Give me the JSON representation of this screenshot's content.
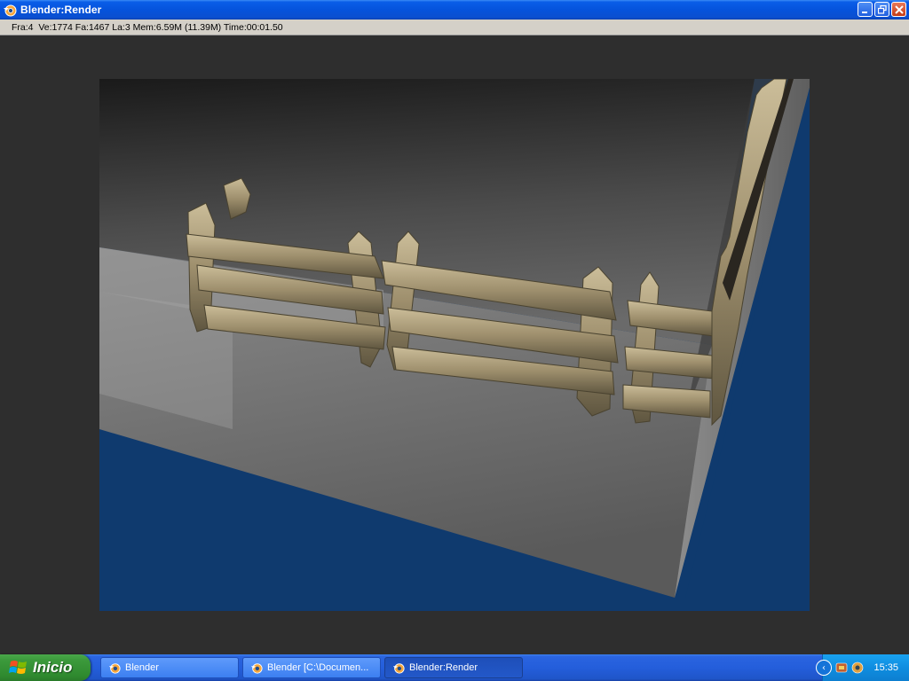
{
  "window": {
    "title": "Blender:Render"
  },
  "stats": {
    "text": "Fra:4  Ve:1774 Fa:1467 La:3 Mem:6.59M (11.39M) Time:00:01.50"
  },
  "taskbar": {
    "start_label": "Inicio",
    "tasks": [
      {
        "label": "Blender"
      },
      {
        "label": "Blender [C:\\Documen..."
      },
      {
        "label": "Blender:Render"
      }
    ],
    "clock": "15:35"
  },
  "colors": {
    "xp_blue": "#245edb",
    "start_green": "#3c9a3c",
    "render_blue": "#0f3a6e",
    "wood": "#a59574"
  },
  "icons": [
    "blender-logo-icon",
    "minimize-icon",
    "maximize-icon",
    "close-icon",
    "windows-logo-icon",
    "tray-chevron-icon",
    "tray-app-icon"
  ]
}
